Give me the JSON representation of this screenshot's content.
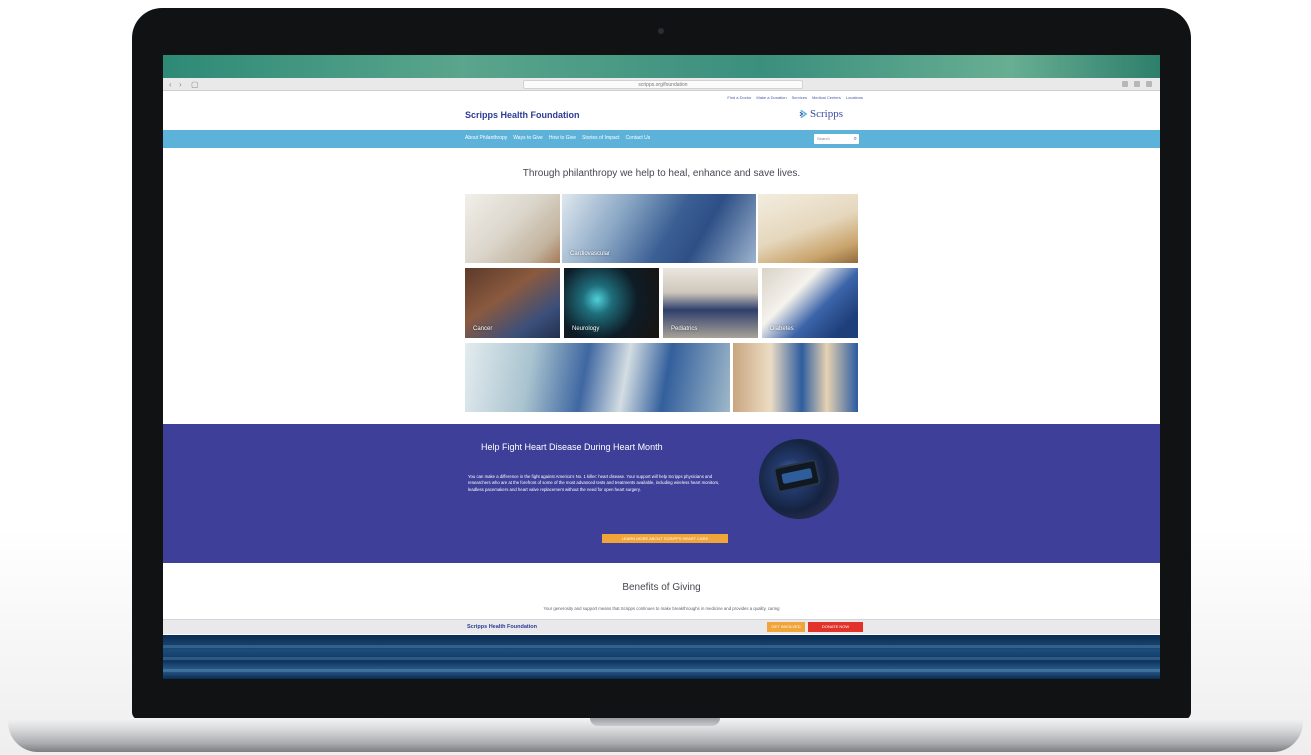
{
  "browser": {
    "url": "scripps.org/foundation"
  },
  "site": {
    "top_links": [
      "Find a Doctor",
      "Make a Donation",
      "Services",
      "Medical Centers",
      "Locations"
    ],
    "brand_name": "Scripps Health Foundation",
    "logo_text": "Scripps",
    "nav": [
      "About Philanthropy",
      "Ways to Give",
      "How to Give",
      "Stories of Impact",
      "Contact Us"
    ],
    "search_placeholder": "Search",
    "tagline": "Through philanthropy we help to heal, enhance and save lives."
  },
  "grid": {
    "captions": [
      "Cardiovascular",
      "Cancer",
      "Neurology",
      "Pediatrics",
      "Diabetes"
    ]
  },
  "heart": {
    "title": "Help Fight Heart Disease During Heart Month",
    "body": "You can make a difference in the fight against America's No. 1 killer: heart disease. Your support will help Scripps physicians and researchers who are at the forefront of some of the most advanced tests and treatments available, including wireless heart monitors, leadless pacemakers and heart valve replacement without the need for open heart surgery.",
    "button": "LEARN MORE ABOUT SCRIPPS HEART CARE"
  },
  "benefits": {
    "title": "Benefits of Giving",
    "subtitle": "Your generosity and support means that Scripps continues to make breakthroughs in medicine and provides a quality, caring"
  },
  "footer": {
    "brand": "Scripps Health Foundation",
    "button_1": "GET INVOLVED",
    "button_2": "DONATE NOW"
  },
  "colors": {
    "nav_bar": "#5cb2d8",
    "brand_blue": "#2c3b96",
    "heart_band": "#3d3f99",
    "orange": "#f0a53a",
    "red": "#e2332a"
  }
}
